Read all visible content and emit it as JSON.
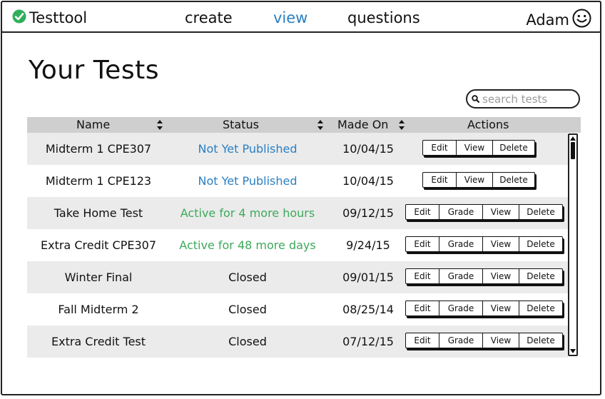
{
  "app": {
    "name": "Testtool"
  },
  "nav": {
    "create": "create",
    "view": "view",
    "questions": "questions"
  },
  "user": {
    "name": "Adam"
  },
  "page": {
    "title": "Your Tests"
  },
  "search": {
    "placeholder": "search tests"
  },
  "table": {
    "headers": {
      "name": "Name",
      "status": "Status",
      "made_on": "Made On",
      "actions": "Actions"
    },
    "rows": [
      {
        "name": "Midterm 1 CPE307",
        "status": "Not Yet Published",
        "status_color": "#2a7fc2",
        "date": "10/04/15",
        "actions": [
          "Edit",
          "View",
          "Delete"
        ]
      },
      {
        "name": "Midterm 1 CPE123",
        "status": "Not Yet Published",
        "status_color": "#2a7fc2",
        "date": "10/04/15",
        "actions": [
          "Edit",
          "View",
          "Delete"
        ]
      },
      {
        "name": "Take Home Test",
        "status": "Active for 4 more hours",
        "status_color": "#3caa5a",
        "date": "09/12/15",
        "actions": [
          "Edit",
          "Grade",
          "View",
          "Delete"
        ]
      },
      {
        "name": "Extra Credit CPE307",
        "status": "Active for 48 more days",
        "status_color": "#3caa5a",
        "date": "9/24/15",
        "actions": [
          "Edit",
          "Grade",
          "View",
          "Delete"
        ]
      },
      {
        "name": "Winter Final",
        "status": "Closed",
        "status_color": "#111111",
        "date": "09/01/15",
        "actions": [
          "Edit",
          "Grade",
          "View",
          "Delete"
        ]
      },
      {
        "name": "Fall Midterm 2",
        "status": "Closed",
        "status_color": "#111111",
        "date": "08/25/14",
        "actions": [
          "Edit",
          "Grade",
          "View",
          "Delete"
        ]
      },
      {
        "name": "Extra Credit Test",
        "status": "Closed",
        "status_color": "#111111",
        "date": "07/12/15",
        "actions": [
          "Edit",
          "Grade",
          "View",
          "Delete"
        ]
      }
    ]
  },
  "colors": {
    "accent": "#2a7fc2",
    "active": "#3caa5a",
    "brand_check": "#2fae5b",
    "header_bg": "#cfcfcf",
    "row_shade": "#ebebeb"
  },
  "icons": {
    "brand": "check-circle-icon",
    "user": "smiley-icon",
    "search": "search-icon",
    "sort": "sort-arrows-icon"
  }
}
